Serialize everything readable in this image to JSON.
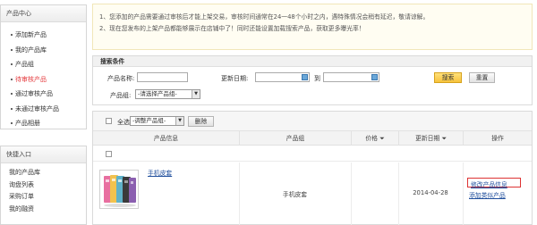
{
  "sidebar": {
    "product_center": {
      "title": "产品中心",
      "items": [
        {
          "label": "添加新产品",
          "active": false
        },
        {
          "label": "我的产品库",
          "active": false
        },
        {
          "label": "产品组",
          "active": false
        },
        {
          "label": "待审核产品",
          "active": true
        },
        {
          "label": "通过审核产品",
          "active": false
        },
        {
          "label": "未通过审核产品",
          "active": false
        },
        {
          "label": "产品相册",
          "active": false
        }
      ]
    },
    "quick_entry": {
      "title": "快捷入口",
      "items": [
        "我的产品库",
        "询盘列表",
        "采购订单",
        "我的融资"
      ]
    }
  },
  "notice": {
    "line1": "1、您添加的产品需要通过审核后才能上架交易，审核时间通常在24一48个小时之内，遇特殊情况会稍有延迟，敬请谅解。",
    "line2": "2、现在您发布的上架产品都能够展示在店铺中了！同时还能设置加载搜索产品，获取更多曝光率！"
  },
  "search": {
    "title": "搜索条件",
    "product_name_label": "产品名称:",
    "product_name_value": "",
    "update_date_label": "更新日期:",
    "date_from": "",
    "to_label": "到",
    "date_to": "",
    "search_button": "搜索",
    "reset_button": "重置",
    "product_group_label": "产品组:",
    "product_group_select": "-请选择产品组-"
  },
  "list": {
    "select_all_label": "全选",
    "adjust_group_select": "-调整产品组-",
    "delete_button": "删除",
    "columns": {
      "info": "产品信息",
      "group": "产品组",
      "price": "价格",
      "date": "更新日期",
      "ops": "操作"
    },
    "rows": [
      {
        "title": "手机皮套",
        "group": "手机皮套",
        "price": "",
        "date": "2014-04-28",
        "op_edit": "修改产品信息",
        "op_add": "添加类似产品"
      }
    ]
  },
  "colors": {
    "active_item": "#e4393c",
    "link": "#1f4e9c",
    "highlight_box": "#dd3333",
    "search_button": "#f7c33c"
  }
}
